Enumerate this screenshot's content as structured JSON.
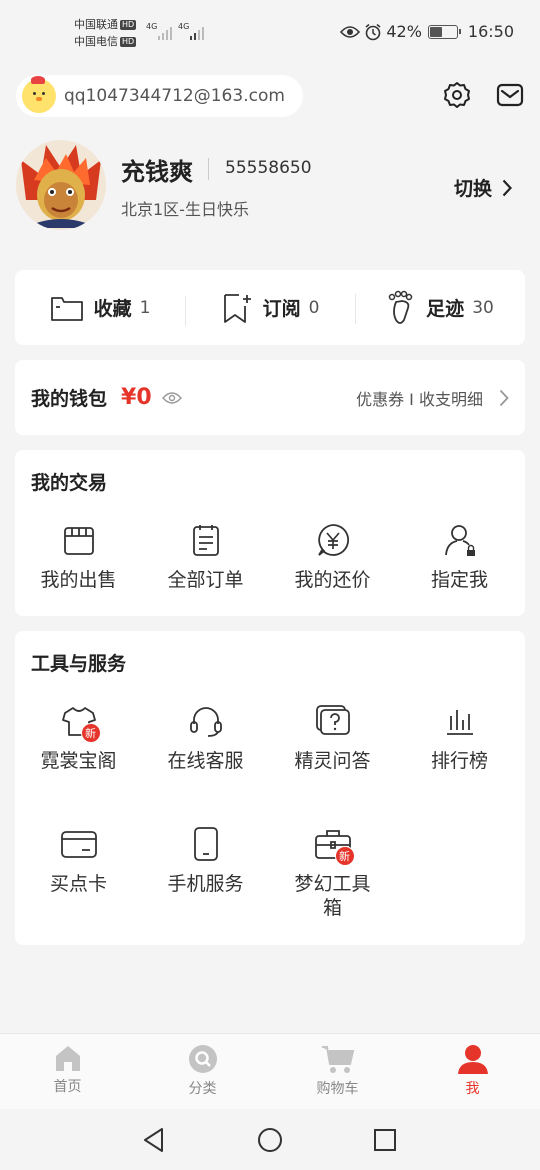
{
  "status_bar": {
    "carrier1": "中国联通",
    "carrier2": "中国电信",
    "hd": "HD",
    "net1": "4G",
    "net2": "4G",
    "battery": "42%",
    "time": "16:50"
  },
  "account": {
    "email": "qq1047344712@163.com"
  },
  "profile": {
    "nickname": "充钱爽",
    "uid": "55558650",
    "server": "北京1区-生日快乐",
    "switch_label": "切换"
  },
  "stats": [
    {
      "label": "收藏",
      "count": "1",
      "icon": "folder-icon"
    },
    {
      "label": "订阅",
      "count": "0",
      "icon": "bookmark-add-icon"
    },
    {
      "label": "足迹",
      "count": "30",
      "icon": "footprint-icon"
    }
  ],
  "wallet": {
    "title": "我的钱包",
    "amount": "¥0",
    "links": "优惠券 I 收支明细"
  },
  "trade": {
    "title": "我的交易",
    "items": [
      {
        "label": "我的出售",
        "icon": "store-icon"
      },
      {
        "label": "全部订单",
        "icon": "order-list-icon"
      },
      {
        "label": "我的还价",
        "icon": "yen-bubble-icon"
      },
      {
        "label": "指定我",
        "icon": "person-lock-icon"
      }
    ]
  },
  "tools": {
    "title": "工具与服务",
    "items": [
      {
        "label": "霓裳宝阁",
        "icon": "shirt-icon",
        "badge": "新"
      },
      {
        "label": "在线客服",
        "icon": "headset-icon"
      },
      {
        "label": "精灵问答",
        "icon": "question-bubble-icon"
      },
      {
        "label": "排行榜",
        "icon": "ranking-icon"
      },
      {
        "label": "买点卡",
        "icon": "card-icon"
      },
      {
        "label": "手机服务",
        "icon": "phone-icon"
      },
      {
        "label": "梦幻工具箱",
        "icon": "toolbox-icon",
        "badge": "新"
      }
    ]
  },
  "tabbar": [
    {
      "label": "首页",
      "icon": "home-icon"
    },
    {
      "label": "分类",
      "icon": "category-search-icon"
    },
    {
      "label": "购物车",
      "icon": "cart-icon"
    },
    {
      "label": "我",
      "icon": "profile-icon",
      "active": true
    }
  ],
  "colors": {
    "accent": "#e5352b",
    "background": "#f4f4f4",
    "card": "#ffffff"
  }
}
